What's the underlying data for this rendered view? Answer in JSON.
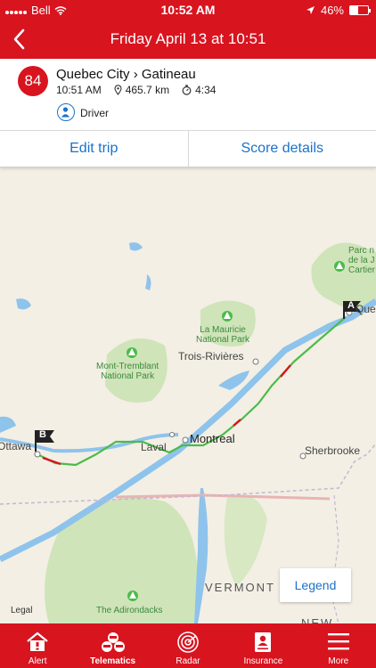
{
  "status_bar": {
    "carrier": "Bell",
    "time": "10:52 AM",
    "battery": "46%",
    "battery_level": 0.46
  },
  "nav": {
    "title": "Friday April 13 at 10:51"
  },
  "trip": {
    "score": "84",
    "route": "Quebec City › Gatineau",
    "start_time": "10:51 AM",
    "distance": "465.7 km",
    "duration": "4:34",
    "role": "Driver"
  },
  "actions": {
    "edit": "Edit trip",
    "score_details": "Score details"
  },
  "map": {
    "cities": {
      "ottawa": "Ottawa",
      "laval": "Laval",
      "montreal": "Montreal",
      "trois_rivieres": "Trois-Rivières",
      "sherbrooke": "Sherbrooke",
      "quebec": "Que"
    },
    "parks": {
      "mauricie_1": "La Mauricie",
      "mauricie_2": "National Park",
      "tremblant_1": "Mont-Tremblant",
      "tremblant_2": "National Park",
      "jacques_1": "Parc n",
      "jacques_2": "de la J",
      "jacques_3": "Cartier",
      "adirondacks": "The Adirondacks"
    },
    "states": {
      "vermont": "VERMONT",
      "new": "NEW"
    },
    "markers": {
      "start": "A",
      "end": "B"
    },
    "legal": "Legal",
    "legend_button": "Legend"
  },
  "tabs": [
    {
      "label": "Alert",
      "icon": "house-alert-icon"
    },
    {
      "label": "Telematics",
      "icon": "car-stack-icon"
    },
    {
      "label": "Radar",
      "icon": "radar-icon"
    },
    {
      "label": "Insurance",
      "icon": "insurance-document-icon"
    },
    {
      "label": "More",
      "icon": "menu-icon"
    }
  ],
  "colors": {
    "brand_red": "#d8141f",
    "link_blue": "#1a72c9",
    "route_green": "#4cbb4a",
    "route_red": "#d8141f"
  }
}
